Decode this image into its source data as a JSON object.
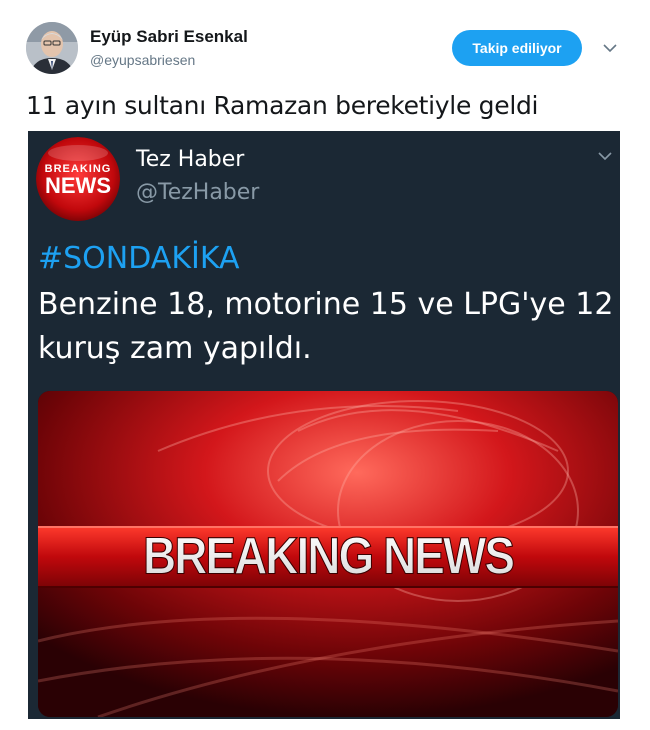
{
  "tweet": {
    "author_name": "Eyüp Sabri Esenkal",
    "author_handle": "@eyupsabriesen",
    "follow_label": "Takip ediliyor",
    "text": "11 ayın sultanı Ramazan bereketiyle geldi"
  },
  "embedded": {
    "author_name": "Tez Haber",
    "author_handle": "@TezHaber",
    "hashtag": "#SONDAKİKA",
    "body": "Benzine 18, motorine 15 ve LPG'ye 12 kuruş zam yapıldı.",
    "logo_text_top": "BREAKING",
    "logo_text_bottom": "NEWS",
    "image_caption": "BREAKING NEWS"
  },
  "icons": {
    "caret": "chevron-down-icon",
    "embedded_caret": "chevron-down-icon"
  },
  "colors": {
    "accent": "#1da1f2",
    "embedded_bg": "#1b2834",
    "handle_grey": "#657786",
    "embedded_handle": "#8899a6"
  }
}
